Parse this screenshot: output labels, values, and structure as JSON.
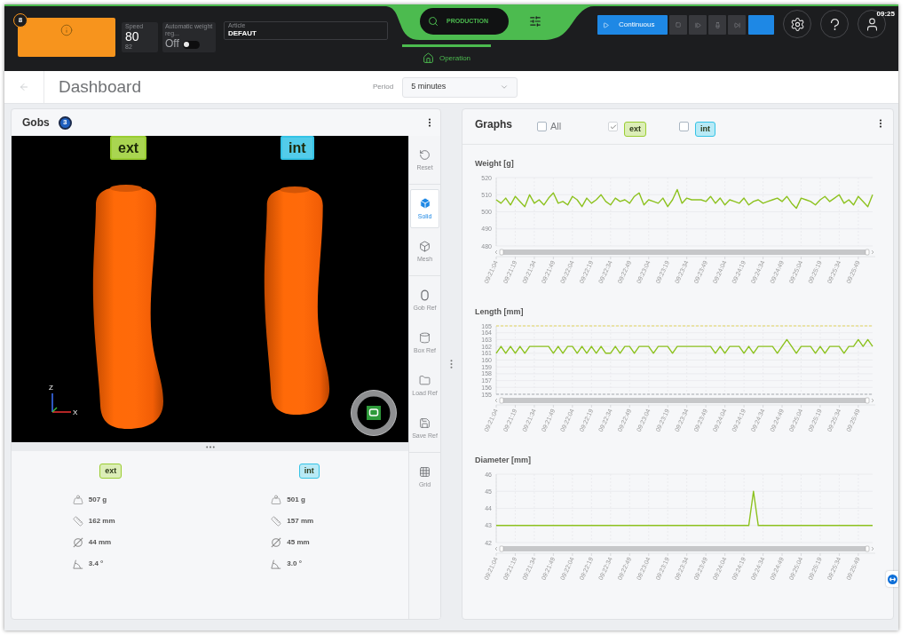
{
  "top_bar": {
    "alarm": {
      "count": "8"
    },
    "speed": {
      "label": "Speed",
      "value": "80",
      "setpoint": "82"
    },
    "auto_weight": {
      "label": "Automatic weight reg...",
      "value": "Off",
      "on": false
    },
    "article": {
      "label": "Article",
      "value": "DEFAUT"
    },
    "mode": "PRODUCTION",
    "tabs": [
      {
        "label": "Operation",
        "selected": true
      }
    ],
    "run_mode": {
      "label": "Continuous",
      "selected": true
    },
    "step_buttons": [
      {
        "selected": false
      },
      {
        "selected": false
      },
      {
        "selected": false
      },
      {
        "selected": false
      },
      {
        "selected": true
      }
    ],
    "time": "09:25"
  },
  "page": {
    "title": "Dashboard",
    "period": {
      "label": "Period",
      "value": "5 minutes"
    }
  },
  "gobs": {
    "title": "Gobs",
    "count": "3",
    "viewer": {
      "tags": [
        {
          "label": "ext",
          "color": "#9acd32"
        },
        {
          "label": "int",
          "color": "#35c3e6"
        }
      ],
      "axes": {
        "vertical": "Z",
        "horizontal": "X"
      }
    },
    "tool_groups": [
      {
        "tools": [
          {
            "label": "Reset",
            "selected": false
          }
        ]
      },
      {
        "tools": [
          {
            "label": "Solid",
            "selected": true
          },
          {
            "label": "Mesh",
            "selected": false
          }
        ]
      },
      {
        "tools": [
          {
            "label": "Gob Ref",
            "selected": false
          },
          {
            "label": "Box Ref",
            "selected": false
          },
          {
            "label": "Load Ref",
            "selected": false
          },
          {
            "label": "Save Ref",
            "selected": false
          }
        ]
      },
      {
        "tools": [
          {
            "label": "Grid",
            "selected": false
          }
        ]
      }
    ],
    "stats": [
      {
        "tag": {
          "label": "ext",
          "color": "#9acd32"
        },
        "weight": "507 g",
        "length": "162 mm",
        "diameter": "44 mm",
        "angle": "3.4 °"
      },
      {
        "tag": {
          "label": "int",
          "color": "#35c3e6"
        },
        "weight": "501 g",
        "length": "157 mm",
        "diameter": "45 mm",
        "angle": "3.0 °"
      }
    ]
  },
  "graphs": {
    "title": "Graphs",
    "filters": [
      {
        "kind": "plain",
        "label": "All",
        "checked": false
      },
      {
        "kind": "tag",
        "label": "ext",
        "color": "#9acd32",
        "checked": true
      },
      {
        "kind": "tag",
        "label": "int",
        "color": "#35c3e6",
        "checked": false
      }
    ],
    "charts": [
      {
        "chart_data": {
          "type": "line",
          "title": "Weight [g]",
          "grid": true,
          "categories": [
            "09:21:04",
            null,
            null,
            null,
            "09:21:19",
            null,
            null,
            null,
            "09:21:34",
            null,
            null,
            null,
            "09:21:49",
            null,
            null,
            null,
            "09:22:04",
            null,
            null,
            null,
            "09:22:19",
            null,
            null,
            null,
            "09:22:34",
            null,
            null,
            null,
            "09:22:49",
            null,
            null,
            null,
            "09:23:04",
            null,
            null,
            null,
            "09:23:19",
            null,
            null,
            null,
            "09:23:34",
            null,
            null,
            null,
            "09:23:49",
            null,
            null,
            null,
            "09:24:04",
            null,
            null,
            null,
            "09:24:19",
            null,
            null,
            null,
            "09:24:34",
            null,
            null,
            null,
            "09:24:49",
            null,
            null,
            null,
            "09:25:04",
            null,
            null,
            null,
            "09:25:19",
            null,
            null,
            null,
            "09:25:34",
            null,
            null,
            null,
            "09:25:49",
            null,
            null,
            null
          ],
          "ylim": [
            480,
            520
          ],
          "yticks": [
            480,
            490,
            500,
            510,
            520
          ],
          "series": [
            {
              "color": "#8dc21f",
              "values": [
                507,
                505,
                508,
                504,
                509,
                506,
                503,
                510,
                505,
                507,
                504,
                508,
                511,
                505,
                506,
                504,
                509,
                507,
                503,
                508,
                505,
                507,
                510,
                506,
                504,
                508,
                506,
                507,
                505,
                509,
                511,
                504,
                507,
                506,
                505,
                508,
                503,
                507,
                513,
                505,
                508,
                507,
                507,
                507,
                506,
                509,
                505,
                508,
                504,
                507,
                506,
                505,
                508,
                504,
                506,
                507,
                505,
                506,
                507,
                508,
                506,
                509,
                505,
                502,
                508,
                507,
                506,
                504,
                507,
                509,
                506,
                508,
                510,
                505,
                507,
                504,
                509,
                506,
                503,
                510
              ]
            }
          ]
        }
      },
      {
        "chart_data": {
          "type": "line",
          "title": "Length [mm]",
          "grid": true,
          "categories": [
            "09:21:04",
            null,
            null,
            null,
            "09:21:19",
            null,
            null,
            null,
            "09:21:34",
            null,
            null,
            null,
            "09:21:49",
            null,
            null,
            null,
            "09:22:04",
            null,
            null,
            null,
            "09:22:19",
            null,
            null,
            null,
            "09:22:34",
            null,
            null,
            null,
            "09:22:49",
            null,
            null,
            null,
            "09:23:04",
            null,
            null,
            null,
            "09:23:19",
            null,
            null,
            null,
            "09:23:34",
            null,
            null,
            null,
            "09:23:49",
            null,
            null,
            null,
            "09:24:04",
            null,
            null,
            null,
            "09:24:19",
            null,
            null,
            null,
            "09:24:34",
            null,
            null,
            null,
            "09:24:49",
            null,
            null,
            null,
            "09:25:04",
            null,
            null,
            null,
            "09:25:19",
            null,
            null,
            null,
            "09:25:34",
            null,
            null,
            null,
            "09:25:49",
            null,
            null,
            null
          ],
          "ylim": [
            155,
            165
          ],
          "yticks": [
            155,
            156,
            157,
            158,
            159,
            160,
            161,
            162,
            163,
            164,
            165
          ],
          "series": [
            {
              "color": "#8dc21f",
              "values": [
                161,
                162,
                161,
                162,
                161,
                162,
                161,
                162,
                162,
                162,
                162,
                162,
                161,
                162,
                161,
                162,
                162,
                161,
                162,
                161,
                162,
                161,
                162,
                161,
                161,
                162,
                161,
                162,
                162,
                161,
                162,
                162,
                162,
                161,
                162,
                162,
                162,
                161,
                162,
                162,
                162,
                162,
                162,
                162,
                162,
                162,
                161,
                162,
                161,
                162,
                162,
                162,
                161,
                162,
                161,
                162,
                162,
                162,
                162,
                161,
                162,
                163,
                162,
                161,
                162,
                162,
                162,
                161,
                162,
                161,
                162,
                162,
                162,
                161,
                162,
                162,
                163,
                162,
                163,
                162
              ]
            }
          ],
          "ref_lines": [
            {
              "axis": "y",
              "value": 165,
              "color": "#e2d55f"
            },
            {
              "axis": "y",
              "value": 155,
              "color": "#a9adb3"
            }
          ]
        }
      },
      {
        "chart_data": {
          "type": "line",
          "title": "Diameter [mm]",
          "grid": true,
          "categories": [
            "09:21:04",
            null,
            null,
            null,
            "09:21:19",
            null,
            null,
            null,
            "09:21:34",
            null,
            null,
            null,
            "09:21:49",
            null,
            null,
            null,
            "09:22:04",
            null,
            null,
            null,
            "09:22:19",
            null,
            null,
            null,
            "09:22:34",
            null,
            null,
            null,
            "09:22:49",
            null,
            null,
            null,
            "09:23:04",
            null,
            null,
            null,
            "09:23:19",
            null,
            null,
            null,
            "09:23:34",
            null,
            null,
            null,
            "09:23:49",
            null,
            null,
            null,
            "09:24:04",
            null,
            null,
            null,
            "09:24:19",
            null,
            null,
            null,
            "09:24:34",
            null,
            null,
            null,
            "09:24:49",
            null,
            null,
            null,
            "09:25:04",
            null,
            null,
            null,
            "09:25:19",
            null,
            null,
            null,
            "09:25:34",
            null,
            null,
            null,
            "09:25:49",
            null,
            null,
            null
          ],
          "ylim": [
            42,
            46
          ],
          "yticks": [
            42,
            43,
            44,
            45,
            46
          ],
          "series": [
            {
              "color": "#8dc21f",
              "values": [
                43,
                43,
                43,
                43,
                43,
                43,
                43,
                43,
                43,
                43,
                43,
                43,
                43,
                43,
                43,
                43,
                43,
                43,
                43,
                43,
                43,
                43,
                43,
                43,
                43,
                43,
                43,
                43,
                43,
                43,
                43,
                43,
                43,
                43,
                43,
                43,
                43,
                43,
                43,
                43,
                43,
                43,
                43,
                43,
                43,
                43,
                43,
                43,
                43,
                43,
                43,
                43,
                43,
                43,
                45,
                43,
                43,
                43,
                43,
                43,
                43,
                43,
                43,
                43,
                43,
                43,
                43,
                43,
                43,
                43,
                43,
                43,
                43,
                43,
                43,
                43,
                43,
                43,
                43,
                43
              ]
            }
          ]
        }
      }
    ]
  }
}
